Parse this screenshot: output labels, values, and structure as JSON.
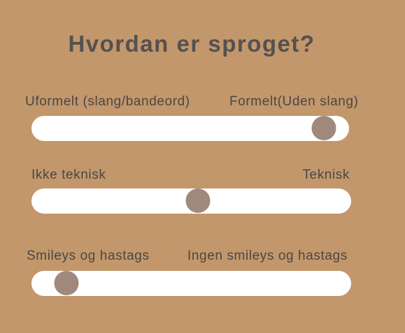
{
  "title": "Hvordan er sproget?",
  "colors": {
    "background": "#C2976B",
    "track": "#FFFFFF",
    "thumb": "#A0897C",
    "text": "#4A4746"
  },
  "sliders": [
    {
      "left_label": "Uformelt (slang/bandeord)",
      "right_label": "Formelt(Uden slang)",
      "value": 0.92
    },
    {
      "left_label": "Ikke teknisk",
      "right_label": "Teknisk",
      "value": 0.52
    },
    {
      "left_label": "Smileys og hastags",
      "right_label": "Ingen smileys og hastags",
      "value": 0.11
    }
  ]
}
